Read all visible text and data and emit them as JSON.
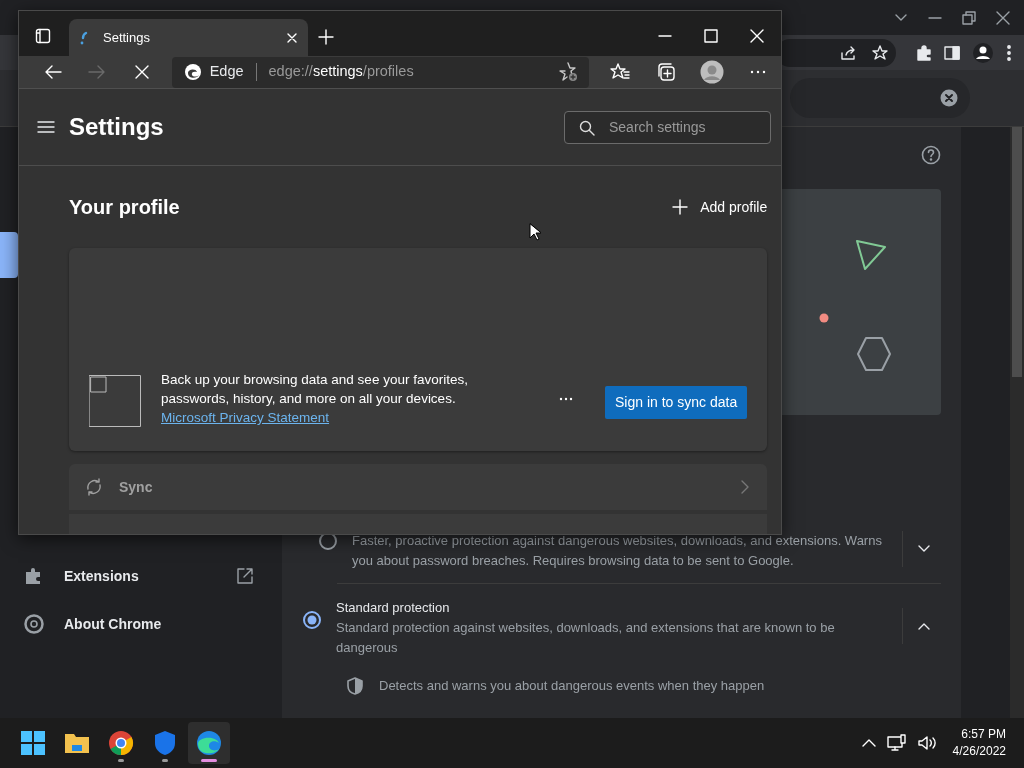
{
  "chrome_window": {
    "sidebar": {
      "items": [
        {
          "label": "Extensions",
          "kind": "extensions"
        },
        {
          "label": "About Chrome",
          "kind": "about"
        }
      ]
    },
    "protection_options": [
      {
        "description": "Faster, proactive protection against dangerous websites, downloads, and extensions. Warns you about password breaches. Requires browsing data to be sent to Google.",
        "selected": false,
        "expanded": false
      },
      {
        "title": "Standard protection",
        "description": "Standard protection against websites, downloads, and extensions that are known to be dangerous",
        "selected": true,
        "expanded": true,
        "details": [
          "Detects and warns you about dangerous events when they happen"
        ]
      }
    ]
  },
  "edge_window": {
    "tabs": [
      {
        "title": "Settings",
        "selected": true
      }
    ],
    "nav_buttons": [
      {
        "kind": "back",
        "disabled": false
      },
      {
        "kind": "forward",
        "disabled": true
      },
      {
        "kind": "stop",
        "disabled": false
      }
    ],
    "address": {
      "site": "Edge",
      "scheme": "edge://",
      "host": "settings",
      "path": "/profiles"
    },
    "page": {
      "title": "Settings",
      "search_placeholder": "Search settings",
      "heading": "Your profile",
      "add_profile": "Add profile",
      "sync_card": {
        "message": "Back up your browsing data and see your favorites, passwords, history, and more on all your devices.",
        "link": "Microsoft Privacy Statement",
        "button": "Sign in to sync data"
      },
      "rows": [
        {
          "label": "Sync",
          "kind": "sync"
        }
      ]
    }
  },
  "taskbar": {
    "apps": [
      {
        "kind": "start",
        "open": false,
        "active": false
      },
      {
        "kind": "folder",
        "open": false,
        "active": false
      },
      {
        "kind": "chrome",
        "open": true,
        "active": false
      },
      {
        "kind": "shield",
        "open": true,
        "active": false
      },
      {
        "kind": "edge",
        "open": true,
        "active": true
      }
    ],
    "clock": {
      "time": "6:57 PM",
      "date": "4/26/2022"
    }
  }
}
